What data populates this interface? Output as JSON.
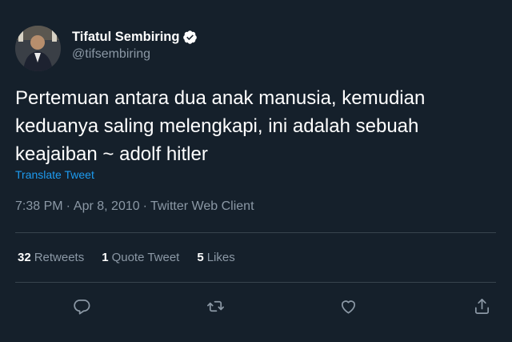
{
  "author": {
    "display_name": "Tifatul Sembiring",
    "handle": "@tifsembiring",
    "verified_icon": "verified-badge-icon",
    "avatar_icon": "avatar"
  },
  "tweet": {
    "text": "Pertemuan antara dua anak manusia, kemudian keduanya saling melengkapi, ini adalah sebuah keajaiban ~ adolf hitler",
    "translate_label": "Translate Tweet",
    "time": "7:38 PM",
    "date": "Apr 8, 2010",
    "client": "Twitter Web Client",
    "separator": "·"
  },
  "stats": {
    "retweets_count": "32",
    "retweets_label": "Retweets",
    "quotes_count": "1",
    "quotes_label": "Quote Tweet",
    "likes_count": "5",
    "likes_label": "Likes"
  },
  "actions": {
    "reply_icon": "reply-icon",
    "retweet_icon": "retweet-icon",
    "like_icon": "heart-icon",
    "share_icon": "share-icon"
  },
  "colors": {
    "background": "#15202b",
    "primary_text": "#ffffff",
    "secondary_text": "#8b98a5",
    "accent": "#1d9bf0",
    "divider": "#38444d"
  }
}
